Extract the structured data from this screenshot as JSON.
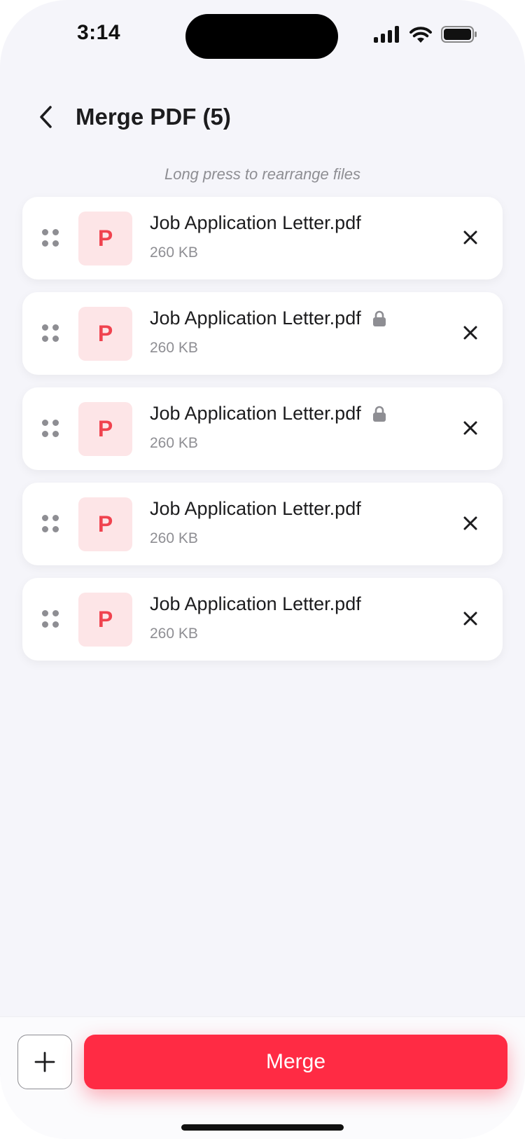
{
  "status_bar": {
    "time": "3:14"
  },
  "header": {
    "title": "Merge PDF (5)"
  },
  "hint": "Long press to rearrange files",
  "files": [
    {
      "icon_letter": "P",
      "name": "Job Application Letter.pdf",
      "size": "260 KB",
      "locked": false
    },
    {
      "icon_letter": "P",
      "name": "Job Application Letter.pdf",
      "size": "260 KB",
      "locked": true
    },
    {
      "icon_letter": "P",
      "name": "Job Application Letter.pdf",
      "size": "260 KB",
      "locked": true
    },
    {
      "icon_letter": "P",
      "name": "Job Application Letter.pdf",
      "size": "260 KB",
      "locked": false
    },
    {
      "icon_letter": "P",
      "name": "Job Application Letter.pdf",
      "size": "260 KB",
      "locked": false
    }
  ],
  "actions": {
    "add_icon": "plus-icon",
    "merge_label": "Merge"
  },
  "colors": {
    "accent": "#ff2b44",
    "pdf_icon_bg": "#fde5e7",
    "pdf_icon_fg": "#f0434f",
    "background": "#f5f5fa"
  }
}
